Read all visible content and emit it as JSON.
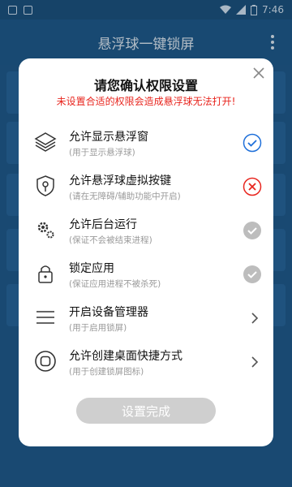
{
  "status_bar": {
    "time": "7:46"
  },
  "app_bar": {
    "title": "悬浮球一键锁屏"
  },
  "dialog": {
    "title": "请您确认权限设置",
    "warning": "未设置合适的权限会造成悬浮球无法打开!",
    "items": [
      {
        "label": "允许显示悬浮窗",
        "sub": "(用于显示悬浮球)",
        "icon": "layers-icon",
        "status": "checked-blue"
      },
      {
        "label": "允许悬浮球虚拟按键",
        "sub": "(请在无障碍/辅助功能中开启)",
        "icon": "shield-key-icon",
        "status": "error-red"
      },
      {
        "label": "允许后台运行",
        "sub": "(保证不会被结束进程)",
        "icon": "gears-icon",
        "status": "checked-gray"
      },
      {
        "label": "锁定应用",
        "sub": "(保证应用进程不被杀死)",
        "icon": "lock-icon",
        "status": "checked-gray"
      },
      {
        "label": "开启设备管理器",
        "sub": "(用于启用锁屏)",
        "icon": "menu-icon",
        "status": "chevron"
      },
      {
        "label": "允许创建桌面快捷方式",
        "sub": "(用于创建锁屏图标)",
        "icon": "shortcut-icon",
        "status": "chevron"
      }
    ],
    "done_button": "设置完成"
  },
  "colors": {
    "accent_blue": "#1e6fd9",
    "error_red": "#e8251e",
    "muted_gray": "#bdbdbd",
    "app_bar": "#1e5a8b"
  }
}
